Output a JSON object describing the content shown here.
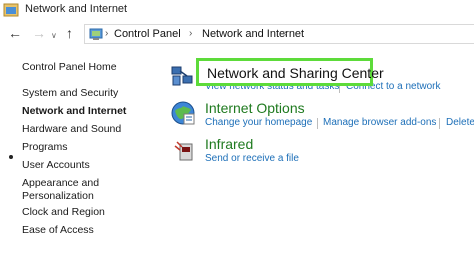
{
  "window": {
    "title": "Network and Internet"
  },
  "addressbar": {
    "breadcrumb": [
      "Control Panel",
      "Network and Internet"
    ],
    "icons": {
      "back": "arrow-left-icon",
      "forward": "arrow-right-icon",
      "recent": "chevron-down-icon",
      "up": "arrow-up-icon"
    }
  },
  "sidebar": {
    "items": [
      {
        "label": "Control Panel Home"
      },
      {
        "label": "System and Security"
      },
      {
        "label": "Network and Internet",
        "active": true
      },
      {
        "label": "Hardware and Sound"
      },
      {
        "label": "Programs"
      },
      {
        "label": "User Accounts"
      },
      {
        "label": "Appearance and"
      },
      {
        "label": "Personalization"
      },
      {
        "label": "Clock and Region"
      },
      {
        "label": "Ease of Access"
      }
    ]
  },
  "main": {
    "network_sharing": {
      "title": "Network and Sharing Center",
      "tasks": [
        "View network status and tasks",
        "Connect to a network"
      ]
    },
    "internet_options": {
      "title": "Internet Options",
      "tasks": [
        "Change your homepage",
        "Manage browser add-ons",
        "Delete"
      ]
    },
    "infrared": {
      "title": "Infrared",
      "tasks": [
        "Send or receive a file"
      ]
    }
  },
  "colors": {
    "highlight_border": "#5ddb3a",
    "category_title": "#1f7a1f",
    "task_link": "#1d6fb8"
  }
}
